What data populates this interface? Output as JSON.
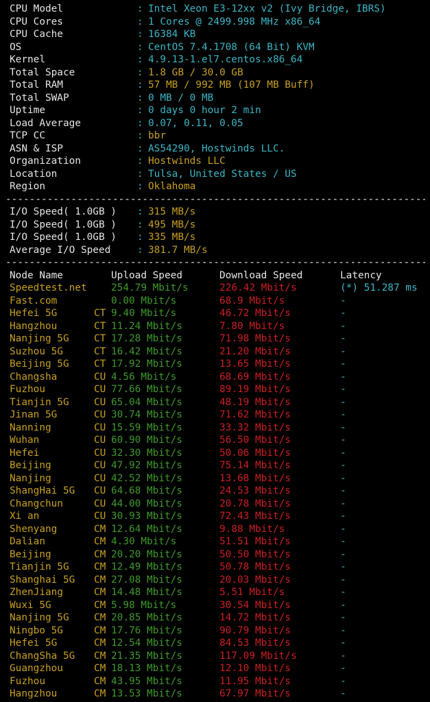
{
  "sysinfo": [
    {
      "label": "CPU Model",
      "value": "Intel Xeon E3-12xx v2 (Ivy Bridge, IBRS)",
      "color": "#3cb6c6"
    },
    {
      "label": "CPU Cores",
      "value": "1 Cores @ 2499.998 MHz x86_64",
      "color": "#3cb6c6"
    },
    {
      "label": "CPU Cache",
      "value": "16384 KB",
      "color": "#3cb6c6"
    },
    {
      "label": "OS",
      "value": "CentOS 7.4.1708 (64 Bit) KVM",
      "color": "#3cb6c6"
    },
    {
      "label": "Kernel",
      "value": "4.9.13-1.el7.centos.x86_64",
      "color": "#3cb6c6"
    },
    {
      "label": "Total Space",
      "value": "1.8 GB / 30.0 GB",
      "color": "#c8a020"
    },
    {
      "label": "Total RAM",
      "value": "57 MB / 992 MB (107 MB Buff)",
      "color": "#c8a020"
    },
    {
      "label": "Total SWAP",
      "value": "0 MB / 0 MB",
      "color": "#3cb6c6"
    },
    {
      "label": "Uptime",
      "value": "0 days 0 hour 2 min",
      "color": "#3cb6c6"
    },
    {
      "label": "Load Average",
      "value": "0.07, 0.11, 0.05",
      "color": "#3cb6c6"
    },
    {
      "label": "TCP CC",
      "value": "bbr",
      "color": "#c8a020"
    },
    {
      "label": "ASN & ISP",
      "value": "AS54290, Hostwinds LLC.",
      "color": "#3cb6c6"
    },
    {
      "label": "Organization",
      "value": "Hostwinds LLC",
      "color": "#c8a020"
    },
    {
      "label": "Location",
      "value": "Tulsa, United States / US",
      "color": "#3cb6c6"
    },
    {
      "label": "Region",
      "value": "Oklahoma",
      "color": "#c8a020"
    }
  ],
  "separator": "------------------------------------------------------------------------------",
  "io": [
    {
      "label": "I/O Speed( 1.0GB )",
      "value": "315 MB/s"
    },
    {
      "label": "I/O Speed( 1.0GB )",
      "value": "495 MB/s"
    },
    {
      "label": "I/O Speed( 1.0GB )",
      "value": "335 MB/s"
    },
    {
      "label": "Average I/O Speed",
      "value": "381.7 MB/s"
    }
  ],
  "speed_headers": {
    "node": "Node Name",
    "upload": "Upload Speed",
    "download": "Download Speed",
    "latency": "Latency"
  },
  "speed_rows": [
    {
      "node": "Speedtest.net",
      "isp": "",
      "upload": "254.79 Mbit/s",
      "download": "226.42 Mbit/s",
      "latency": "(*) 51.287 ms"
    },
    {
      "node": "Fast.com",
      "isp": "",
      "upload": "0.00 Mbit/s",
      "download": "68.9 Mbit/s",
      "latency": "-"
    },
    {
      "node": "Hefei 5G",
      "isp": "CT",
      "upload": "9.40 Mbit/s",
      "download": "46.72 Mbit/s",
      "latency": "-"
    },
    {
      "node": "Hangzhou",
      "isp": "CT",
      "upload": "11.24 Mbit/s",
      "download": "7.80 Mbit/s",
      "latency": "-"
    },
    {
      "node": "Nanjing 5G",
      "isp": "CT",
      "upload": "17.28 Mbit/s",
      "download": "71.98 Mbit/s",
      "latency": "-"
    },
    {
      "node": "Suzhou 5G",
      "isp": "CT",
      "upload": "16.42 Mbit/s",
      "download": "21.20 Mbit/s",
      "latency": "-"
    },
    {
      "node": "Beijing 5G",
      "isp": "CT",
      "upload": "17.92 Mbit/s",
      "download": "13.65 Mbit/s",
      "latency": "-"
    },
    {
      "node": "Changsha",
      "isp": "CU",
      "upload": "4.56 Mbit/s",
      "download": "68.69 Mbit/s",
      "latency": "-"
    },
    {
      "node": "Fuzhou",
      "isp": "CU",
      "upload": "77.66 Mbit/s",
      "download": "89.19 Mbit/s",
      "latency": "-"
    },
    {
      "node": "Tianjin 5G",
      "isp": "CU",
      "upload": "65.04 Mbit/s",
      "download": "48.19 Mbit/s",
      "latency": "-"
    },
    {
      "node": "Jinan 5G",
      "isp": "CU",
      "upload": "30.74 Mbit/s",
      "download": "71.62 Mbit/s",
      "latency": "-"
    },
    {
      "node": "Nanning",
      "isp": "CU",
      "upload": "15.59 Mbit/s",
      "download": "33.32 Mbit/s",
      "latency": "-"
    },
    {
      "node": "Wuhan",
      "isp": "CU",
      "upload": "60.90 Mbit/s",
      "download": "56.50 Mbit/s",
      "latency": "-"
    },
    {
      "node": "Hefei",
      "isp": "CU",
      "upload": "32.30 Mbit/s",
      "download": "50.06 Mbit/s",
      "latency": "-"
    },
    {
      "node": "Beijing",
      "isp": "CU",
      "upload": "47.92 Mbit/s",
      "download": "75.14 Mbit/s",
      "latency": "-"
    },
    {
      "node": "Nanjing",
      "isp": "CU",
      "upload": "42.52 Mbit/s",
      "download": "13.68 Mbit/s",
      "latency": "-"
    },
    {
      "node": "ShangHai 5G",
      "isp": "CU",
      "upload": "64.68 Mbit/s",
      "download": "24.53 Mbit/s",
      "latency": "-"
    },
    {
      "node": "Changchun",
      "isp": "CU",
      "upload": "44.00 Mbit/s",
      "download": "20.78 Mbit/s",
      "latency": "-"
    },
    {
      "node": "Xi an",
      "isp": "CU",
      "upload": "30.93 Mbit/s",
      "download": "72.43 Mbit/s",
      "latency": "-"
    },
    {
      "node": "Shenyang",
      "isp": "CM",
      "upload": "12.64 Mbit/s",
      "download": "9.88 Mbit/s",
      "latency": "-"
    },
    {
      "node": "Dalian",
      "isp": "CM",
      "upload": "4.30 Mbit/s",
      "download": "51.51 Mbit/s",
      "latency": "-"
    },
    {
      "node": "Beijing",
      "isp": "CM",
      "upload": "20.20 Mbit/s",
      "download": "50.50 Mbit/s",
      "latency": "-"
    },
    {
      "node": "Tianjin 5G",
      "isp": "CM",
      "upload": "12.49 Mbit/s",
      "download": "50.78 Mbit/s",
      "latency": "-"
    },
    {
      "node": "Shanghai 5G",
      "isp": "CM",
      "upload": "27.08 Mbit/s",
      "download": "20.03 Mbit/s",
      "latency": "-"
    },
    {
      "node": "ZhenJiang",
      "isp": "CM",
      "upload": "14.48 Mbit/s",
      "download": "5.51 Mbit/s",
      "latency": "-"
    },
    {
      "node": "Wuxi 5G",
      "isp": "CM",
      "upload": "5.98 Mbit/s",
      "download": "30.54 Mbit/s",
      "latency": "-"
    },
    {
      "node": "Nanjing 5G",
      "isp": "CM",
      "upload": "20.85 Mbit/s",
      "download": "14.72 Mbit/s",
      "latency": "-"
    },
    {
      "node": "Ningbo 5G",
      "isp": "CM",
      "upload": "17.76 Mbit/s",
      "download": "90.79 Mbit/s",
      "latency": "-"
    },
    {
      "node": "Hefei 5G",
      "isp": "CM",
      "upload": "12.54 Mbit/s",
      "download": "84.53 Mbit/s",
      "latency": "-"
    },
    {
      "node": "ChangSha 5G",
      "isp": "CM",
      "upload": "21.35 Mbit/s",
      "download": "117.09 Mbit/s",
      "latency": "-"
    },
    {
      "node": "Guangzhou",
      "isp": "CM",
      "upload": "18.13 Mbit/s",
      "download": "12.10 Mbit/s",
      "latency": "-"
    },
    {
      "node": "Fuzhou",
      "isp": "CM",
      "upload": "43.95 Mbit/s",
      "download": "11.95 Mbit/s",
      "latency": "-"
    },
    {
      "node": "Hangzhou",
      "isp": "CM",
      "upload": "13.53 Mbit/s",
      "download": "67.97 Mbit/s",
      "latency": "-"
    }
  ]
}
